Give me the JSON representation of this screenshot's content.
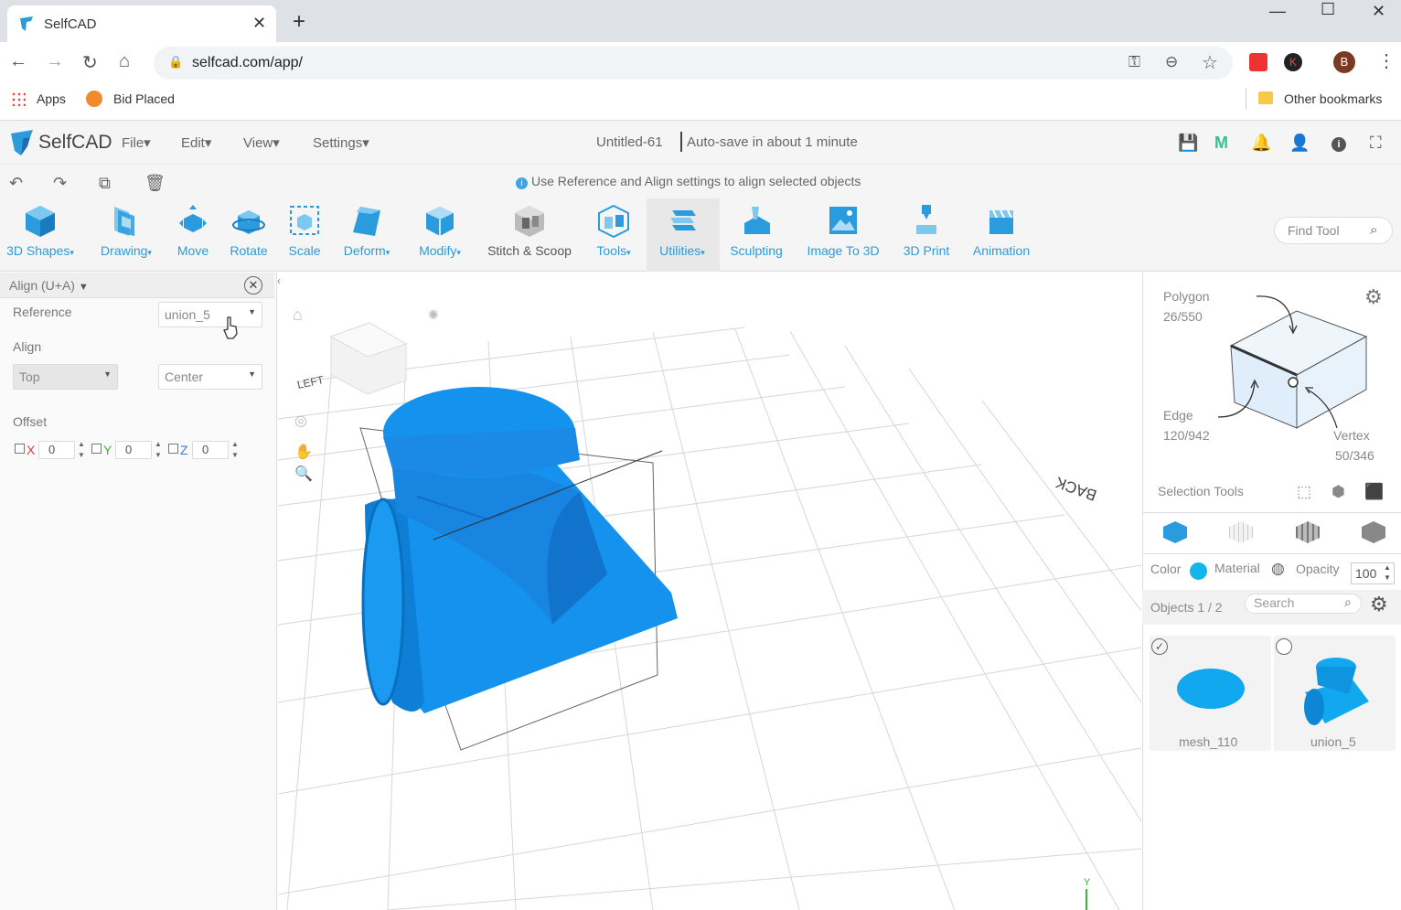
{
  "browser": {
    "tab_title": "SelfCAD",
    "url": "selfcad.com/app/",
    "bookmarks": {
      "apps": "Apps",
      "bid_placed": "Bid Placed",
      "other": "Other bookmarks"
    },
    "profile_initial": "B",
    "ext_initial": "K"
  },
  "app": {
    "logo": "SelfCAD",
    "menus": [
      "File",
      "Edit",
      "View",
      "Settings"
    ],
    "doc_title": "Untitled-61",
    "autosave": "Auto-save in about 1 minute",
    "hint": "Use Reference and Align settings to align selected objects"
  },
  "tools": [
    {
      "label": "3D Shapes",
      "dropdown": true
    },
    {
      "label": "Drawing",
      "dropdown": true
    },
    {
      "label": "Move",
      "dropdown": false
    },
    {
      "label": "Rotate",
      "dropdown": false
    },
    {
      "label": "Scale",
      "dropdown": false
    },
    {
      "label": "Deform",
      "dropdown": true
    },
    {
      "label": "Modify",
      "dropdown": true
    },
    {
      "label": "Stitch & Scoop",
      "dropdown": false
    },
    {
      "label": "Tools",
      "dropdown": true
    },
    {
      "label": "Utilities",
      "dropdown": true
    },
    {
      "label": "Sculpting",
      "dropdown": false
    },
    {
      "label": "Image To 3D",
      "dropdown": false
    },
    {
      "label": "3D Print",
      "dropdown": false
    },
    {
      "label": "Animation",
      "dropdown": false
    }
  ],
  "find_tool_placeholder": "Find Tool",
  "align_panel": {
    "title": "Align (U+A)",
    "reference_label": "Reference",
    "reference_value": "union_5",
    "align_label": "Align",
    "align_value_1": "Top",
    "align_value_2": "Center",
    "offset_label": "Offset",
    "offset": {
      "x": "0",
      "y": "0",
      "z": "0"
    },
    "axis_labels": {
      "x": "X",
      "y": "Y",
      "z": "Z"
    }
  },
  "viewport": {
    "left_label": "LEFT",
    "back_label": "BACK",
    "y_axis": "Y"
  },
  "selection": {
    "polygon_label": "Polygon",
    "polygon_count": "26/550",
    "edge_label": "Edge",
    "edge_count": "120/942",
    "vertex_label": "Vertex",
    "vertex_count": "50/346",
    "selection_tools": "Selection Tools",
    "color_label": "Color",
    "material_label": "Material",
    "opacity_label": "Opacity",
    "opacity_value": "100",
    "objects_label": "Objects 1 / 2",
    "search_placeholder": "Search",
    "objects": [
      "mesh_110",
      "union_5"
    ]
  },
  "colors": {
    "accent": "#2a9bdc",
    "mesh": "#1591ee",
    "color_swatch": "#12b6ea"
  }
}
